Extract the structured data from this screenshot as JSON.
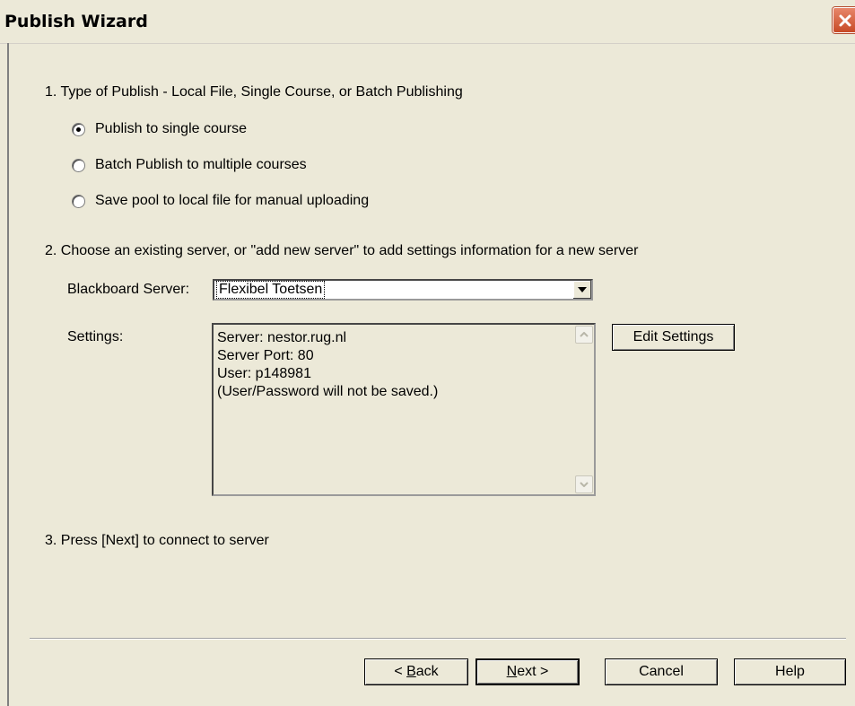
{
  "window": {
    "title": "Publish Wizard",
    "close_icon": "close-icon"
  },
  "step1": {
    "text": "1. Type of Publish - Local File, Single Course, or Batch Publishing",
    "options": [
      {
        "label": "Publish to single course",
        "checked": true
      },
      {
        "label": "Batch Publish to multiple courses",
        "checked": false
      },
      {
        "label": "Save pool to local file for manual uploading",
        "checked": false
      }
    ]
  },
  "step2": {
    "text": "2. Choose an existing server, or \"add new server\" to add settings information for a new server",
    "server_label": "Blackboard Server:",
    "server_value": "Flexibel Toetsen",
    "settings_label": "Settings:",
    "settings_text": "Server: nestor.rug.nl\nServer Port: 80\nUser: p148981\n(User/Password will not be saved.)",
    "edit_settings_label": "Edit Settings"
  },
  "step3": {
    "text": "3. Press [Next] to connect to server"
  },
  "buttons": {
    "back_prefix": "< ",
    "back_accel": "B",
    "back_rest": "ack",
    "next_accel": "N",
    "next_rest": "ext >",
    "cancel": "Cancel",
    "help": "Help"
  }
}
